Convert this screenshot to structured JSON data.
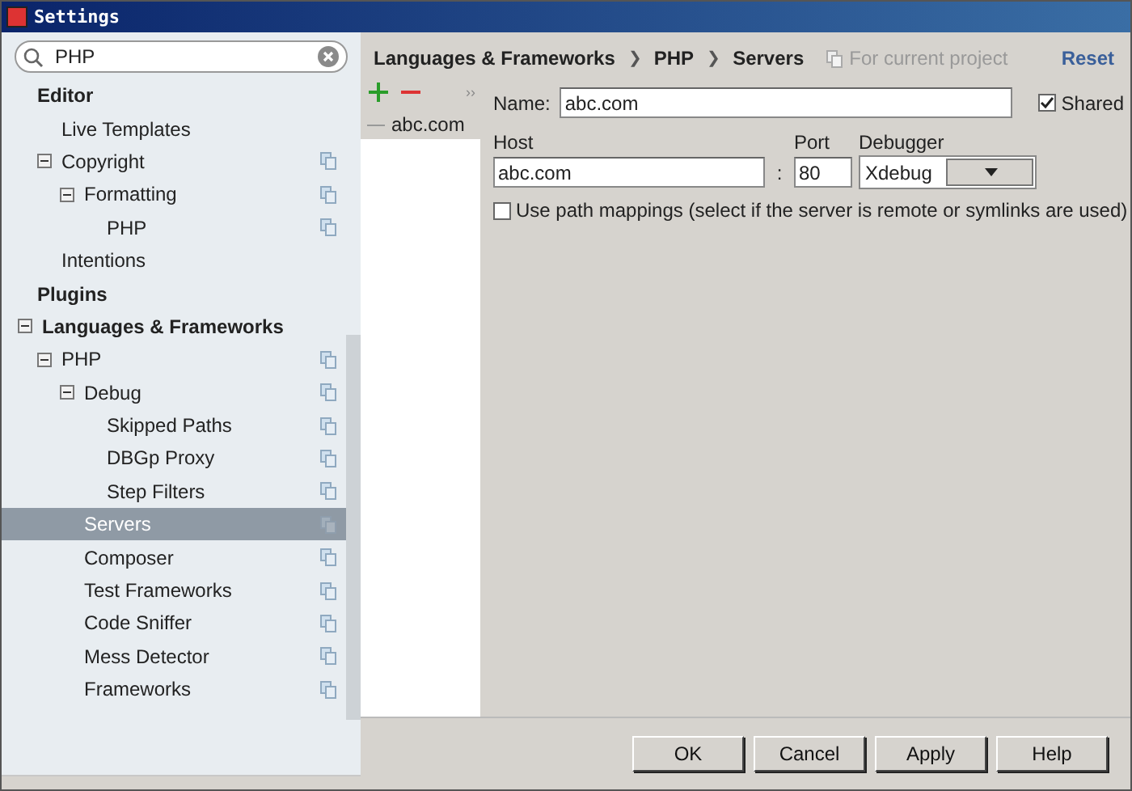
{
  "window": {
    "title": "Settings"
  },
  "search": {
    "value": "PHP"
  },
  "tree": [
    {
      "label": "Editor",
      "selected": false,
      "project_scope": false,
      "children": [
        {
          "label": "Live Templates",
          "selected": false,
          "project_scope": false
        },
        {
          "label": "Copyright",
          "selected": false,
          "project_scope": true,
          "expanded": true,
          "children": [
            {
              "label": "Formatting",
              "selected": false,
              "project_scope": true,
              "expanded": true,
              "children": [
                {
                  "label": "PHP",
                  "selected": false,
                  "project_scope": true
                }
              ]
            }
          ]
        },
        {
          "label": "Intentions",
          "selected": false,
          "project_scope": false
        }
      ]
    },
    {
      "label": "Plugins",
      "selected": false,
      "project_scope": false
    },
    {
      "label": "Languages & Frameworks",
      "selected": false,
      "project_scope": false,
      "expanded": true,
      "children": [
        {
          "label": "PHP",
          "selected": false,
          "project_scope": true,
          "expanded": true,
          "children": [
            {
              "label": "Debug",
              "selected": false,
              "project_scope": true,
              "expanded": true,
              "children": [
                {
                  "label": "Skipped Paths",
                  "selected": false,
                  "project_scope": true
                },
                {
                  "label": "DBGp Proxy",
                  "selected": false,
                  "project_scope": true
                },
                {
                  "label": "Step Filters",
                  "selected": false,
                  "project_scope": true
                }
              ]
            },
            {
              "label": "Servers",
              "selected": true,
              "project_scope": true
            },
            {
              "label": "Composer",
              "selected": false,
              "project_scope": true
            },
            {
              "label": "Test Frameworks",
              "selected": false,
              "project_scope": true
            },
            {
              "label": "Code Sniffer",
              "selected": false,
              "project_scope": true
            },
            {
              "label": "Mess Detector",
              "selected": false,
              "project_scope": true
            },
            {
              "label": "Frameworks",
              "selected": false,
              "project_scope": true
            }
          ]
        }
      ]
    }
  ],
  "breadcrumbs": [
    "Languages & Frameworks",
    "PHP",
    "Servers"
  ],
  "breadcrumb_separator": "❯",
  "more": "››",
  "scope_note": "For current project",
  "reset": "Reset",
  "servers": [
    {
      "label": "abc.com",
      "selected": true
    }
  ],
  "form": {
    "name_label": "Name:",
    "name": "abc.com",
    "shared_label": "Shared",
    "shared": true,
    "host_label": "Host",
    "host": "abc.com",
    "port_sep": ":",
    "port_label": "Port",
    "port": "80",
    "debugger_label": "Debugger",
    "debugger": "Xdebug",
    "path_mappings_label": "Use path mappings (select if the server is remote or symlinks are used)",
    "path_mappings": false
  },
  "buttons": [
    "OK",
    "Cancel",
    "Apply",
    "Help"
  ]
}
